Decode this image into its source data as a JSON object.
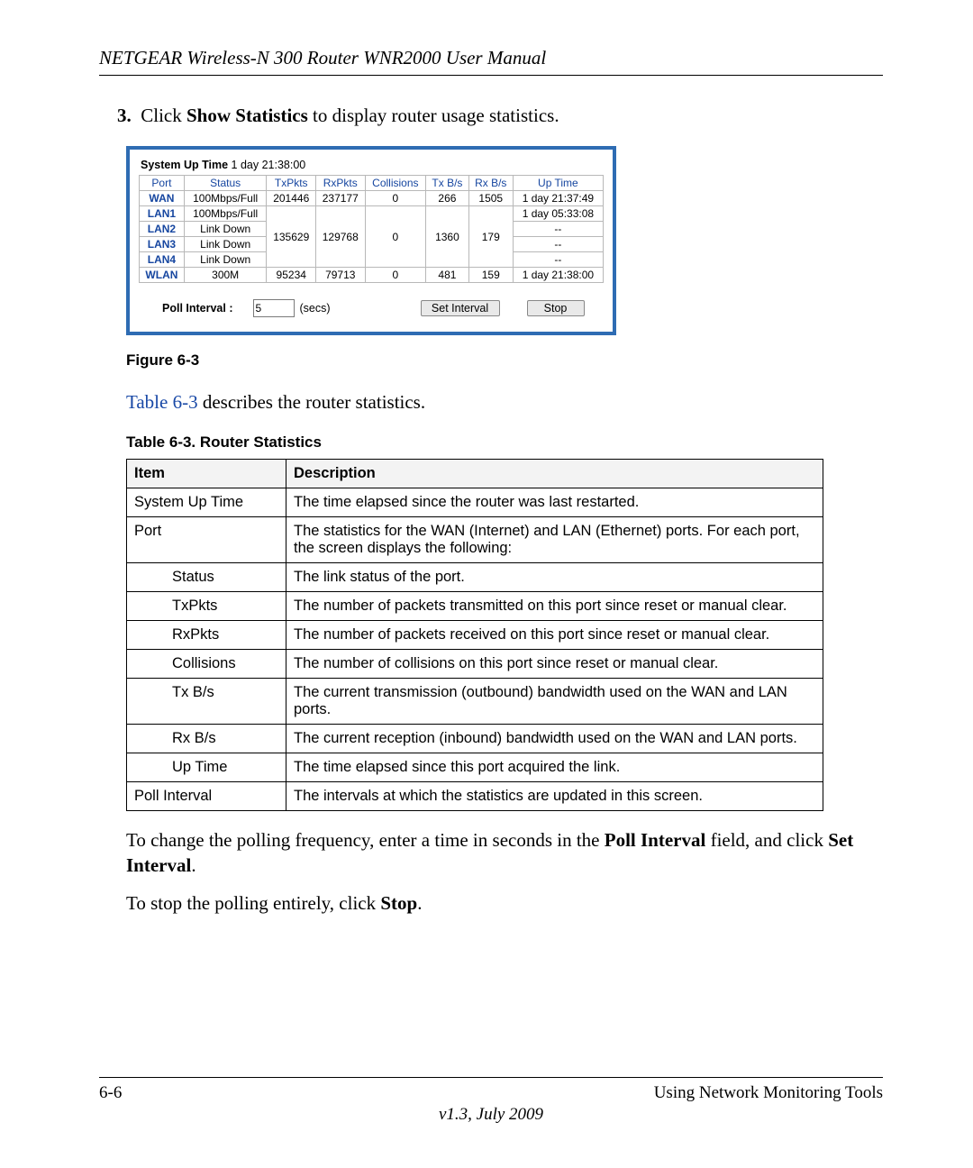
{
  "header": "NETGEAR Wireless-N 300 Router WNR2000 User Manual",
  "step": {
    "num": "3.",
    "text_before": "Click ",
    "bold": "Show Statistics",
    "text_after": " to display router usage statistics."
  },
  "stats_panel": {
    "sys_label": "System Up Time",
    "sys_value": "1 day 21:38:00",
    "headers": [
      "Port",
      "Status",
      "TxPkts",
      "RxPkts",
      "Collisions",
      "Tx B/s",
      "Rx B/s",
      "Up Time"
    ],
    "rows": {
      "wan": {
        "port": "WAN",
        "status": "100Mbps/Full",
        "tx": "201446",
        "rx": "237177",
        "col": "0",
        "txbs": "266",
        "rxbs": "1505",
        "up": "1 day 21:37:49"
      },
      "lan1": {
        "port": "LAN1",
        "status": "100Mbps/Full",
        "up": "1 day 05:33:08"
      },
      "lan2": {
        "port": "LAN2",
        "status": "Link Down",
        "up": "--"
      },
      "lan3": {
        "port": "LAN3",
        "status": "Link Down",
        "up": "--"
      },
      "lan4": {
        "port": "LAN4",
        "status": "Link Down",
        "up": "--"
      },
      "lan_merge": {
        "tx": "135629",
        "rx": "129768",
        "col": "0",
        "txbs": "1360",
        "rxbs": "179"
      },
      "wlan": {
        "port": "WLAN",
        "status": "300M",
        "tx": "95234",
        "rx": "79713",
        "col": "0",
        "txbs": "481",
        "rxbs": "159",
        "up": "1 day 21:38:00"
      }
    },
    "poll_label": "Poll Interval :",
    "poll_value": "5",
    "secs": "(secs)",
    "btn_set": "Set Interval",
    "btn_stop": "Stop"
  },
  "fig_caption": "Figure 6-3",
  "ref_sentence_link": "Table 6-3",
  "ref_sentence_rest": " describes the router statistics.",
  "table_caption": "Table 6-3. Router Statistics",
  "desc_table": {
    "h_item": "Item",
    "h_desc": "Description",
    "rows": [
      {
        "item": "System Up Time",
        "desc": "The time elapsed since the router was last restarted."
      },
      {
        "item": "Port",
        "desc": "The statistics for the WAN (Internet) and LAN (Ethernet) ports. For each port, the screen displays the following:"
      },
      {
        "sub": "Status",
        "desc": "The link status of the port."
      },
      {
        "sub": "TxPkts",
        "desc": "The number of packets transmitted on this port since reset or manual clear."
      },
      {
        "sub": "RxPkts",
        "desc": "The number of packets received on this port since reset or manual clear."
      },
      {
        "sub": "Collisions",
        "desc": "The number of collisions on this port since reset or manual clear."
      },
      {
        "sub": "Tx B/s",
        "desc": "The current transmission (outbound) bandwidth used on the WAN and LAN ports."
      },
      {
        "sub": "Rx B/s",
        "desc": "The current reception (inbound) bandwidth used on the WAN and LAN ports."
      },
      {
        "sub": "Up Time",
        "desc": "The time elapsed since this port acquired the link."
      },
      {
        "item": "Poll Interval",
        "desc": "The intervals at which the statistics are updated in this screen."
      }
    ]
  },
  "post1_a": "To change the polling frequency, enter a time in seconds in the ",
  "post1_b1": "Poll Interval",
  "post1_c": " field, and click ",
  "post1_b2": "Set Interval",
  "post1_d": ".",
  "post2_a": "To stop the polling entirely, click ",
  "post2_b": "Stop",
  "post2_c": ".",
  "footer": {
    "left": "6-6",
    "right": "Using Network Monitoring Tools",
    "version": "v1.3, July 2009"
  }
}
